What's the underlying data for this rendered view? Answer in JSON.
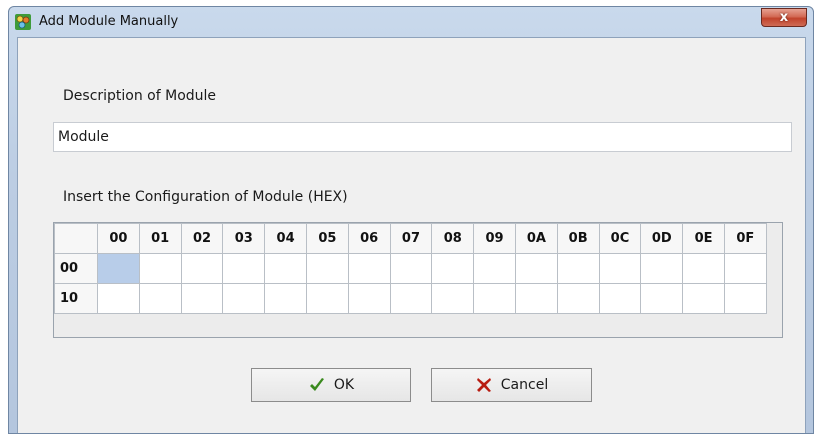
{
  "window": {
    "title": "Add Module Manually",
    "close_label": "x"
  },
  "form": {
    "description_label": "Description of Module",
    "description_value": "Module",
    "config_label": "Insert the Configuration of Module (HEX)"
  },
  "grid": {
    "columns": [
      "00",
      "01",
      "02",
      "03",
      "04",
      "05",
      "06",
      "07",
      "08",
      "09",
      "0A",
      "0B",
      "0C",
      "0D",
      "0E",
      "0F"
    ],
    "rows": [
      "00",
      "10"
    ],
    "selected_cell": {
      "row": "00",
      "col": "00"
    }
  },
  "buttons": {
    "ok_label": "OK",
    "cancel_label": "Cancel"
  },
  "icons": {
    "app": "gear-app-icon",
    "ok": "checkmark-icon",
    "cancel": "x-mark-icon"
  },
  "colors": {
    "ok_check": "#3a8a1e",
    "cancel_x": "#b81d12",
    "selected_cell": "#b8cde9",
    "close_button": "#c1432c"
  }
}
